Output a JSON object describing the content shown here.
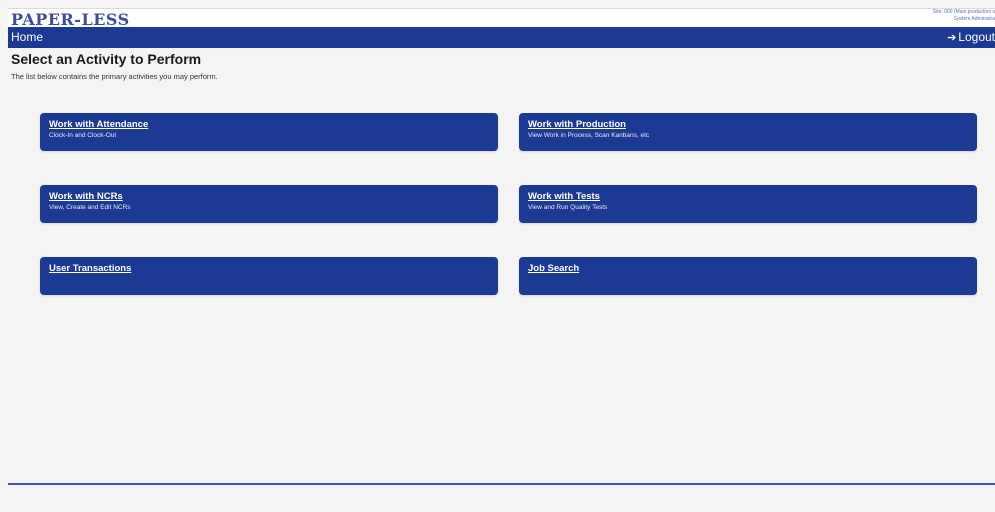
{
  "header": {
    "brand": "PAPER-LESS",
    "site_line": "Site: 000 (Main production s",
    "role_line": "System Administra"
  },
  "nav": {
    "home_label": "Home",
    "logout_label": "Logout"
  },
  "main": {
    "title": "Select an Activity to Perform",
    "subtitle": "The list below contains the primary activities you may perform."
  },
  "activities": [
    {
      "title": "Work with Attendance",
      "description": "Clock-In and Clock-Out"
    },
    {
      "title": "Work with Production",
      "description": "View Work in Process, Scan Kanbans, etc"
    },
    {
      "title": "Work with NCRs",
      "description": "View, Create and Edit NCRs"
    },
    {
      "title": "Work with Tests",
      "description": "View and Run Quality Tests"
    },
    {
      "title": "User Transactions",
      "description": ""
    },
    {
      "title": "Job Search",
      "description": ""
    }
  ],
  "colors": {
    "primary": "#1c3a94",
    "brand_text": "#3a4d9e",
    "background": "#f4f4f4"
  }
}
